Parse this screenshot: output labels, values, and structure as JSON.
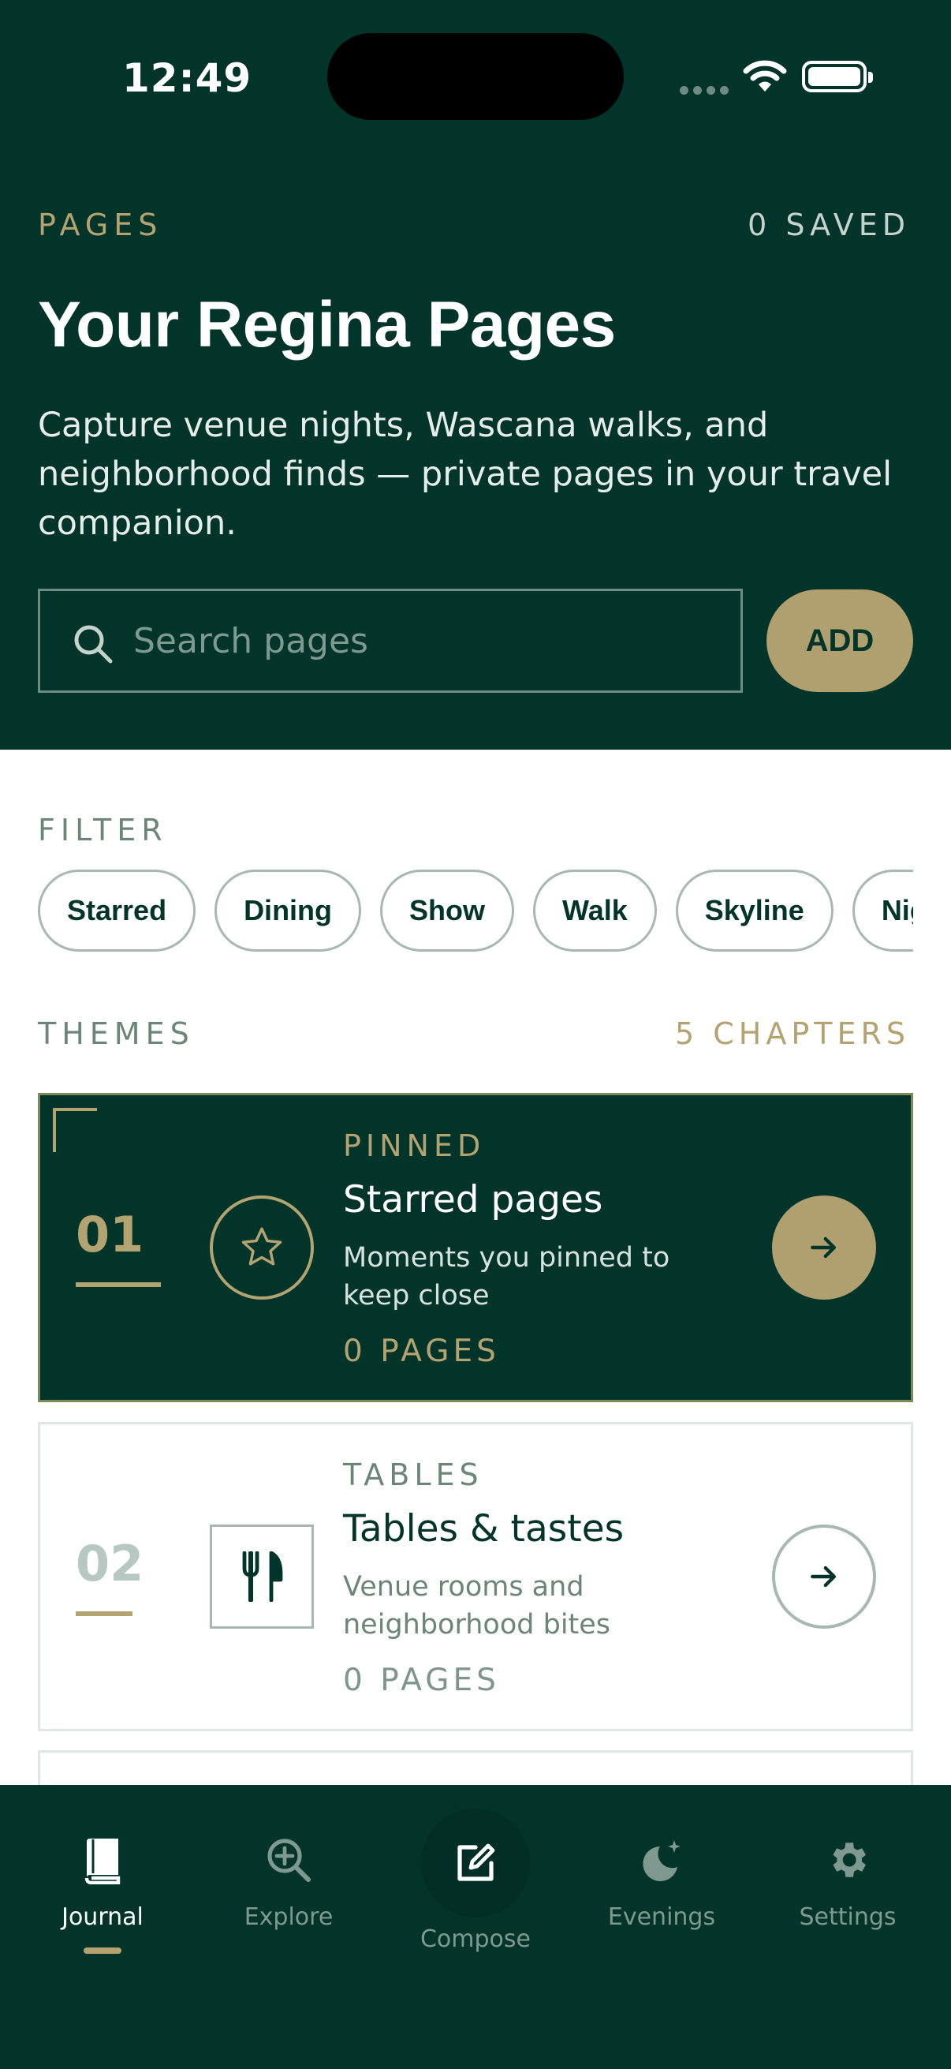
{
  "status_bar": {
    "time": "12:49"
  },
  "header": {
    "eyebrow": "PAGES",
    "saved_count": "0 SAVED",
    "title": "Your Regina Pages",
    "intro": "Capture venue nights, Wascana walks, and neighborhood finds — private pages in your travel companion."
  },
  "search": {
    "placeholder": "Search pages",
    "value": ""
  },
  "add_label": "ADD",
  "filter": {
    "label": "FILTER",
    "chips": [
      "Starred",
      "Dining",
      "Show",
      "Walk",
      "Skyline",
      "Nightlife"
    ]
  },
  "themes": {
    "label": "THEMES",
    "chapters": "5 CHAPTERS",
    "cards": [
      {
        "number": "01",
        "eyebrow": "PINNED",
        "title": "Starred pages",
        "desc": "Moments you pinned to keep close",
        "count": "0 PAGES",
        "icon": "star-icon"
      },
      {
        "number": "02",
        "eyebrow": "TABLES",
        "title": "Tables & tastes",
        "desc": "Venue rooms and neighborhood bites",
        "count": "0 PAGES",
        "icon": "utensils-icon"
      }
    ]
  },
  "tabs": [
    {
      "label": "Journal",
      "icon": "book-icon"
    },
    {
      "label": "Explore",
      "icon": "search-plus-icon"
    },
    {
      "label": "Compose",
      "icon": "compose-icon"
    },
    {
      "label": "Evenings",
      "icon": "moon-stars-icon"
    },
    {
      "label": "Settings",
      "icon": "gear-icon"
    }
  ],
  "colors": {
    "brand": "#02342a",
    "accent": "#b09f6f",
    "muted": "#6b8579"
  }
}
